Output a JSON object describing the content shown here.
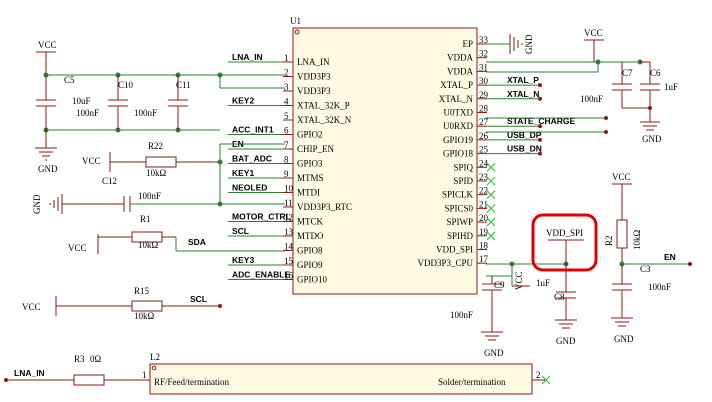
{
  "ref": {
    "u1": "U1",
    "c5": "C5",
    "c10": "C10",
    "c11": "C11",
    "c12": "C12",
    "r22": "R22",
    "r1": "R1",
    "r15": "R15",
    "r3": "R3",
    "r2": "R2",
    "c7": "C7",
    "c6": "C6",
    "c9": "C9",
    "c8": "C8",
    "c3": "C3",
    "l2": "L2"
  },
  "vals": {
    "c5": "10uF",
    "c10": "100nF",
    "c11": "100nF",
    "c12": "100nF",
    "r22": "10kΩ",
    "r1": "10kΩ",
    "r15": "10kΩ",
    "r3": "0Ω",
    "r2": "10kΩ",
    "c7": "100nF",
    "c6": "1uF",
    "c9": "100nF",
    "c8": "1uF",
    "c3": "100nF"
  },
  "power": {
    "vcc": "VCC",
    "gnd": "GND"
  },
  "left_pins": [
    {
      "num": "1",
      "name": "LNA_IN",
      "net": "LNA_IN"
    },
    {
      "num": "2",
      "name": "VDD3P3",
      "net": ""
    },
    {
      "num": "3",
      "name": "VDD3P3",
      "net": ""
    },
    {
      "num": "4",
      "name": "XTAL_32K_P",
      "net": "KEY2"
    },
    {
      "num": "5",
      "name": "XTAL_32K_N",
      "net": ""
    },
    {
      "num": "6",
      "name": "GPIO2",
      "net": "ACC_INT1"
    },
    {
      "num": "7",
      "name": "CHIP_EN",
      "net": "EN"
    },
    {
      "num": "8",
      "name": "GPIO3",
      "net": "BAT_ADC"
    },
    {
      "num": "9",
      "name": "MTMS",
      "net": "KEY1"
    },
    {
      "num": "10",
      "name": "MTDI",
      "net": "NEOLED"
    },
    {
      "num": "11",
      "name": "VDD3P3_RTC",
      "net": ""
    },
    {
      "num": "12",
      "name": "MTCK",
      "net": "MOTOR_CTRL"
    },
    {
      "num": "13",
      "name": "MTDO",
      "net": "SCL"
    },
    {
      "num": "14",
      "name": "GPIO8",
      "net": ""
    },
    {
      "num": "15",
      "name": "GPIO9",
      "net": "KEY3"
    },
    {
      "num": "16",
      "name": "GPIO10",
      "net": "ADC_ENABLE"
    }
  ],
  "right_pins": [
    {
      "num": "33",
      "name": "EP",
      "net": ""
    },
    {
      "num": "32",
      "name": "VDDA",
      "net": ""
    },
    {
      "num": "31",
      "name": "VDDA",
      "net": ""
    },
    {
      "num": "30",
      "name": "XTAL_P",
      "net": "XTAL_P"
    },
    {
      "num": "29",
      "name": "XTAL_N",
      "net": "XTAL_N"
    },
    {
      "num": "28",
      "name": "U0TXD",
      "net": ""
    },
    {
      "num": "27",
      "name": "U0RXD",
      "net": "STATE_CHARGE"
    },
    {
      "num": "26",
      "name": "GPIO19",
      "net": "USB_DP"
    },
    {
      "num": "25",
      "name": "GPIO18",
      "net": "USB_DN"
    },
    {
      "num": "24",
      "name": "SPIQ",
      "net": ""
    },
    {
      "num": "23",
      "name": "SPID",
      "net": ""
    },
    {
      "num": "22",
      "name": "SPICLK",
      "net": ""
    },
    {
      "num": "21",
      "name": "SPICS0",
      "net": ""
    },
    {
      "num": "20",
      "name": "SPIWP",
      "net": ""
    },
    {
      "num": "19",
      "name": "SPIHD",
      "net": ""
    },
    {
      "num": "18",
      "name": "VDD_SPI",
      "net": ""
    },
    {
      "num": "17",
      "name": "VDD3P3_CPU",
      "net": ""
    }
  ],
  "nets": {
    "sda": "SDA",
    "scl": "SCL",
    "en": "EN",
    "lna_in": "LNA_IN",
    "vdd_spi": "VDD_SPI"
  },
  "l2": {
    "pin1": "1",
    "pin2": "2",
    "left": "RF/Feed/termination",
    "right": "Solder/termination"
  }
}
